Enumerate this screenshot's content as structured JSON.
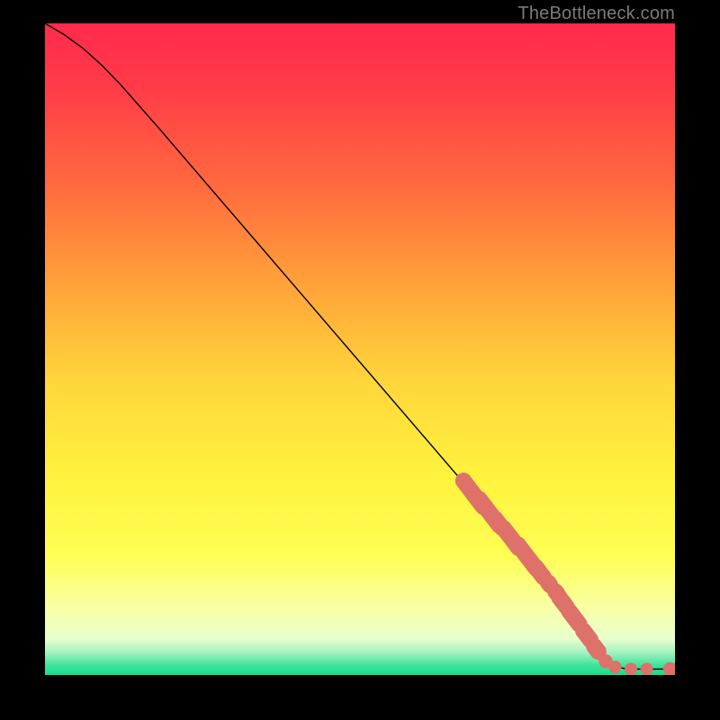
{
  "attribution": "TheBottleneck.com",
  "colors": {
    "curve_stroke": "#000000",
    "marker_fill": "#de7169",
    "gradient_stops": [
      {
        "offset": 0.0,
        "color": "#ff2a4c"
      },
      {
        "offset": 0.1,
        "color": "#ff3c48"
      },
      {
        "offset": 0.25,
        "color": "#ff6a3e"
      },
      {
        "offset": 0.4,
        "color": "#ffa23a"
      },
      {
        "offset": 0.55,
        "color": "#ffd63b"
      },
      {
        "offset": 0.7,
        "color": "#fff33e"
      },
      {
        "offset": 0.82,
        "color": "#feff55"
      },
      {
        "offset": 0.9,
        "color": "#f9ffa8"
      },
      {
        "offset": 0.945,
        "color": "#e7ffce"
      },
      {
        "offset": 0.965,
        "color": "#a6f2c0"
      },
      {
        "offset": 0.985,
        "color": "#3fe39a"
      },
      {
        "offset": 1.0,
        "color": "#17dd8b"
      }
    ]
  },
  "chart_data": {
    "type": "line",
    "title": "",
    "xlabel": "",
    "ylabel": "",
    "xlim": [
      0,
      100
    ],
    "ylim": [
      0,
      100
    ],
    "series": [
      {
        "name": "bottleneck-curve",
        "x": [
          0,
          3,
          6,
          9,
          12,
          15,
          18,
          70,
          88,
          90,
          92,
          94,
          96,
          98,
          100
        ],
        "y": [
          100,
          98.3,
          96.2,
          93.6,
          90.6,
          87.3,
          84.0,
          25.5,
          2.5,
          1.4,
          1.0,
          0.9,
          0.9,
          0.9,
          0.9
        ]
      }
    ],
    "markers": {
      "name": "highlighted-points",
      "color": "#de7169",
      "points": [
        {
          "x": 68.0,
          "y": 27.8,
          "r": 1.3,
          "stretch": 3.0
        },
        {
          "x": 70.5,
          "y": 25.0,
          "r": 1.3,
          "stretch": 3.0
        },
        {
          "x": 72.0,
          "y": 23.3,
          "r": 1.3,
          "stretch": 1.7
        },
        {
          "x": 74.0,
          "y": 21.0,
          "r": 1.3,
          "stretch": 2.5
        },
        {
          "x": 76.5,
          "y": 18.2,
          "r": 1.3,
          "stretch": 2.8
        },
        {
          "x": 78.5,
          "y": 15.8,
          "r": 1.3,
          "stretch": 1.8
        },
        {
          "x": 80.0,
          "y": 14.0,
          "r": 1.3,
          "stretch": 1.2
        },
        {
          "x": 81.2,
          "y": 12.6,
          "r": 1.3,
          "stretch": 1.2
        },
        {
          "x": 82.2,
          "y": 11.2,
          "r": 1.3,
          "stretch": 1.7
        },
        {
          "x": 84.0,
          "y": 8.8,
          "r": 1.3,
          "stretch": 2.0
        },
        {
          "x": 86.0,
          "y": 6.1,
          "r": 1.3,
          "stretch": 1.7
        },
        {
          "x": 87.5,
          "y": 4.0,
          "r": 1.3,
          "stretch": 1.4
        },
        {
          "x": 89.0,
          "y": 2.1,
          "r": 1.1,
          "stretch": 1.0
        },
        {
          "x": 90.5,
          "y": 1.2,
          "r": 1.0,
          "stretch": 1.0
        },
        {
          "x": 93.0,
          "y": 0.9,
          "r": 1.0,
          "stretch": 1.0
        },
        {
          "x": 95.5,
          "y": 0.9,
          "r": 1.0,
          "stretch": 1.0
        },
        {
          "x": 99.2,
          "y": 0.9,
          "r": 1.1,
          "stretch": 1.0
        }
      ]
    }
  }
}
